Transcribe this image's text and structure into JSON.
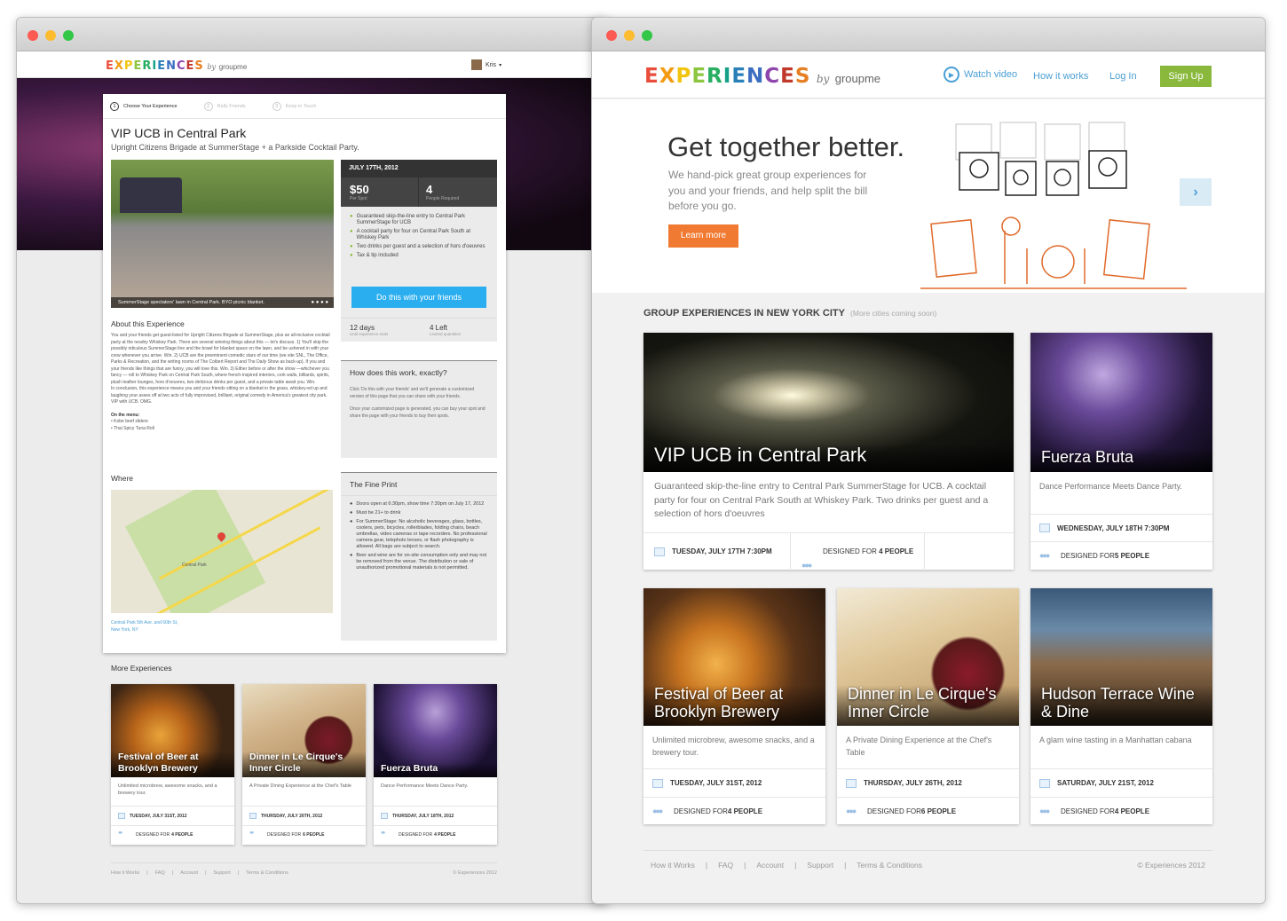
{
  "left": {
    "logo_word": "EXPERIENCES",
    "logo_by": "by",
    "logo_brand": "groupme",
    "user_name": "Kris",
    "steps": [
      "Choose Your Experience",
      "Rally Friends",
      "Keep in Touch"
    ],
    "step_numbers": [
      "1",
      "2",
      "3"
    ],
    "title": "VIP UCB in Central Park",
    "subtitle": "Upright Citizens Brigade at SummerStage + a Parkside Cocktail Party.",
    "photo_caption": "SummerStage spectators' lawn in Central Park. BYO picnic blanket.",
    "date": "JULY 17TH, 2012",
    "price": "$50",
    "price_label": "Per Spot",
    "people": "4",
    "people_label": "People Required",
    "features": [
      "Guaranteed skip-the-line entry to Central Park SummerStage for UCB",
      "A cocktail party for four on Central Park South at Whiskey Park",
      "Two drinks per guest and a selection of hors d'oeuvres",
      "Tax & tip included"
    ],
    "cta": "Do this with your friends",
    "days": "12 days",
    "days_label": "Until experience ends",
    "left_count": "4 Left",
    "left_label": "Limited quantities",
    "about_heading": "About this Experience",
    "about_text": "You and your friends get guest-listed for Upright Citizens Brigade at SummerStage, plus an all-inclusive cocktail party at the nearby Whiskey Park. There are several winning things about this — let's discuss. 1) You'll skip the possibly ridiculous SummerStage line and the brawl for blanket space on the lawn, and be ushered in with your crew whenever you arrive. Win. 2) UCB are the preeminent comedic stars of our time (we site SNL, The Office, Parks & Recreation, and the writing rooms of The Colbert Report and The Daily Show as back-up). If you and your friends like things that are funny, you will love this. Win. 3) Either before or after the show —whichever you fancy — roll to Whiskey Park on Central Park South, where french-inspired interiors, cork walls, billiards, spirits, plush leather lounges, hors d'oeuvres, two delicious drinks per guest, and a private table await you. Win.",
    "about_text2": "In conclusion, this experience means you and your friends sitting on a blanket in the grass, whiskey-ed up and laughing your asses off at two acts of fully improvised, brilliant, original comedy in America's greatest city park. VIP with UCB. OMG.",
    "menu_heading": "On the menu:",
    "menu_items": [
      "• Kobe beef sliders",
      "• Thai Spicy Tuna Roll"
    ],
    "how_heading": "How does this work, exactly?",
    "how_text1": "Click 'Do this with your friends' and we'll generate a customized version of this page that you can share with your friends.",
    "how_text2": "Once your customized page is generated, you can buy your spot and share the page with your friends to buy their spots.",
    "where_heading": "Where",
    "map_label": "Central Park",
    "address1": "Central Park 5th Ave. and 60th St,",
    "address2": "New York, NY",
    "fine_heading": "The Fine Print",
    "fine_items": [
      "Doors open at 6:30pm, show time 7:30pm on July 17, 2012",
      "Must be 21+ to drink",
      "For SummerStage: No alcoholic beverages, glass, bottles, coolers, pets, bicycles, rollerblades, folding chairs, beach umbrellas, video cameras or tape recorders. No professional camera gear, telephoto lenses, or flash photography is allowed. All bags are subject to search.",
      "Beer and wine are for on-site consumption only and may not be removed from the venue. The distribution or sale of unauthorized promotional materials is not permitted."
    ],
    "more_heading": "More Experiences",
    "more": [
      {
        "title": "Festival of Beer at Brooklyn Brewery",
        "desc": "Unlimited microbrew, awesome snacks, and a brewery tour.",
        "date": "TUESDAY, JULY 31ST, 2012",
        "designed": "DESIGNED FOR ",
        "count": "4 PEOPLE"
      },
      {
        "title": "Dinner in Le Cirque's Inner Circle",
        "desc": "A Private Dining Experience at the Chef's Table",
        "date": "THURSDAY, JULY 26TH, 2012",
        "designed": "DESIGNED FOR ",
        "count": "6 PEOPLE"
      },
      {
        "title": "Fuerza Bruta",
        "desc": "Dance Performance Meets Dance Party.",
        "date": "THURSDAY, JULY 18TH, 2012",
        "designed": "DESIGNED FOR ",
        "count": "4 PEOPLE"
      }
    ],
    "footer_links": [
      "How it Works",
      "FAQ",
      "Account",
      "Support",
      "Terms & Conditions"
    ],
    "copyright": "© Experiences 2012"
  },
  "right": {
    "logo_word": "EXPERIENCES",
    "logo_by": "by",
    "logo_brand": "groupme",
    "nav_watch": "Watch video",
    "nav_how": "How it works",
    "nav_login": "Log In",
    "nav_signup": "Sign Up",
    "hero_title": "Get together better.",
    "hero_text": "We hand-pick great group experiences for you and your friends, and help split the bill before you go.",
    "learn_more": "Learn more",
    "section_title": "GROUP EXPERIENCES IN NEW YORK CITY",
    "section_sub": "(More cities coming soon)",
    "featured": {
      "title": "VIP UCB in Central Park",
      "desc": "Guaranteed skip-the-line entry to Central Park SummerStage for UCB. A cocktail party for four on Central Park South at Whiskey Park. Two drinks per guest and a selection of hors d'oeuvres",
      "date": "TUESDAY, JULY 17TH 7:30PM",
      "designed": "DESIGNED FOR ",
      "count": "4 PEOPLE"
    },
    "side": {
      "title": "Fuerza Bruta",
      "desc": "Dance Performance Meets Dance Party.",
      "date": "WEDNESDAY, JULY 18TH 7:30PM",
      "designed": "DESIGNED FOR ",
      "count": "5 PEOPLE"
    },
    "cards": [
      {
        "title": "Festival of Beer at Brooklyn Brewery",
        "desc": "Unlimited microbrew, awesome snacks, and a brewery tour.",
        "date": "TUESDAY, JULY 31ST, 2012",
        "designed": "DESIGNED FOR ",
        "count": "4 PEOPLE"
      },
      {
        "title": "Dinner in Le Cirque's Inner Circle",
        "desc": "A Private Dining Experience at the Chef's Table",
        "date": "THURSDAY, JULY 26TH, 2012",
        "designed": "DESIGNED FOR ",
        "count": "6 PEOPLE"
      },
      {
        "title": "Hudson Terrace Wine & Dine",
        "desc": "A glam wine tasting in a Manhattan cabana",
        "date": "SATURDAY, JULY 21ST, 2012",
        "designed": "DESIGNED FOR ",
        "count": "4 PEOPLE"
      }
    ],
    "footer_links": [
      "How it Works",
      "FAQ",
      "Account",
      "Support",
      "Terms & Conditions"
    ],
    "copyright": "© Experiences 2012"
  },
  "colors": {
    "logo": [
      "#e94e3c",
      "#f39c12",
      "#f1c40f",
      "#8cc63f",
      "#27ae60",
      "#16a085",
      "#2980b9",
      "#3b6ec1",
      "#8e44ad",
      "#c0392b",
      "#e67e22"
    ],
    "cta_blue": "#2aaef0",
    "signup_green": "#8ab83d",
    "learn_orange": "#f07a32",
    "link_blue": "#4a9fd6"
  }
}
